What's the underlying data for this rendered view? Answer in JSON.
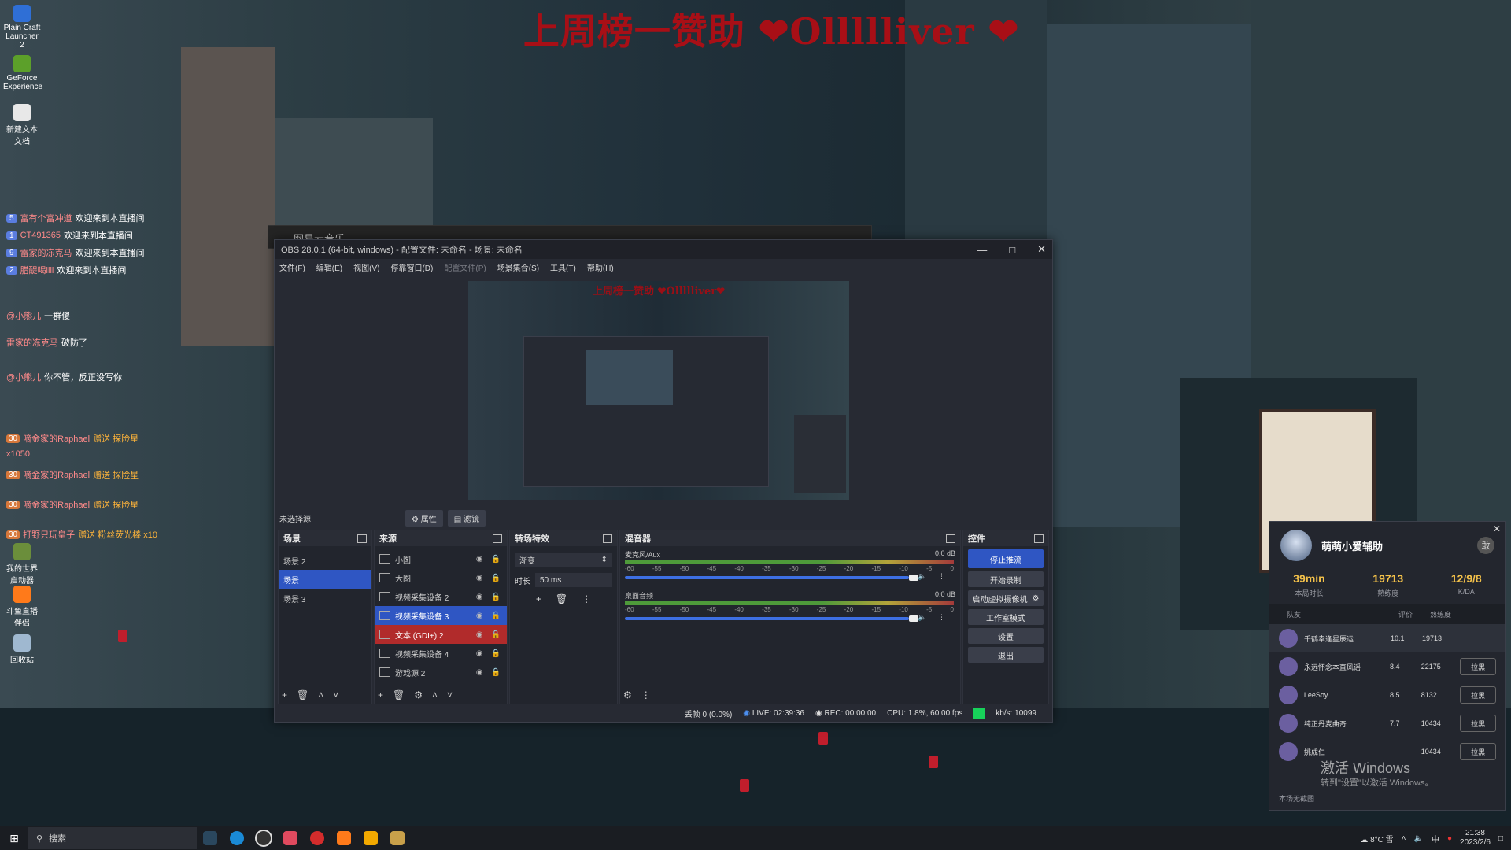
{
  "overlay_title": "上周榜一赞助 ❤Ollllliver ❤",
  "desktop_icons": [
    {
      "label": "Plain Craft Launcher 2",
      "icon": "plain-craft-icon",
      "color": "#2f6fd6"
    },
    {
      "label": "GeForce Experience",
      "icon": "geforce-icon",
      "color": "#5ca02a"
    },
    {
      "label": "新建文本文档",
      "icon": "text-doc-icon",
      "color": "#e8e8e8"
    },
    {
      "label": "我的世界启动器",
      "icon": "minecraft-icon",
      "color": "#6b8e3b"
    },
    {
      "label": "斗鱼直播伴侣",
      "icon": "douyu-icon",
      "color": "#ff7a1a"
    },
    {
      "label": "回收站",
      "icon": "recycle-bin-icon",
      "color": "#9fb8d0"
    }
  ],
  "chat": [
    {
      "level": "5",
      "user": "富有个富冲道",
      "text": "欢迎来到本直播间"
    },
    {
      "level": "1",
      "user": "CT491365",
      "text": "欢迎来到本直播间"
    },
    {
      "level": "9",
      "user": "雷家的冻克马",
      "text": "欢迎来到本直播间"
    },
    {
      "level": "2",
      "user": "腊醍喝illl",
      "text": "欢迎来到本直播间"
    },
    {
      "level": "",
      "user": "@小熊儿",
      "text": "一群傻"
    },
    {
      "level": "",
      "user": "雷家的冻克马",
      "text": "破防了"
    },
    {
      "level": "",
      "user": "@小熊儿",
      "text": "你不管，反正没写你"
    },
    {
      "level": "30",
      "user": "嘀金家的Raphael",
      "text": "赠送 探险星"
    },
    {
      "level": "",
      "user": "x1050",
      "text": ""
    },
    {
      "level": "30",
      "user": "嘀金家的Raphael",
      "text": "赠送 探险星"
    },
    {
      "level": "30",
      "user": "嘀金家的Raphael",
      "text": "赠送 探险星"
    },
    {
      "level": "30",
      "user": "打野只玩皇子",
      "text": "赠送 粉丝荧光棒 x10"
    }
  ],
  "music_window": {
    "title": "网易云音乐"
  },
  "obs": {
    "title": "OBS 28.0.1 (64-bit, windows) - 配置文件: 未命名 - 场景: 未命名",
    "menu": [
      {
        "label": "文件(F)",
        "disabled": false
      },
      {
        "label": "编辑(E)",
        "disabled": false
      },
      {
        "label": "视图(V)",
        "disabled": false
      },
      {
        "label": "停靠窗口(D)",
        "disabled": false
      },
      {
        "label": "配置文件(P)",
        "disabled": true
      },
      {
        "label": "场景集合(S)",
        "disabled": false
      },
      {
        "label": "工具(T)",
        "disabled": false
      },
      {
        "label": "帮助(H)",
        "disabled": false
      }
    ],
    "preview_title": "上周榜一赞助 ❤Ollllliver❤",
    "no_source": "未选择源",
    "props_tab": "属性",
    "filters_tab": "滤镜",
    "scenes": {
      "header": "场景",
      "items": [
        {
          "label": "场景 2",
          "selected": false
        },
        {
          "label": "场景",
          "selected": true
        },
        {
          "label": "场景 3",
          "selected": false
        }
      ]
    },
    "sources": {
      "header": "来源",
      "items": [
        {
          "label": "小图",
          "state": "normal"
        },
        {
          "label": "大图",
          "state": "normal"
        },
        {
          "label": "视频采集设备 2",
          "state": "normal"
        },
        {
          "label": "视频采集设备 3",
          "state": "selected"
        },
        {
          "label": "文本 (GDI+) 2",
          "state": "red"
        },
        {
          "label": "视频采集设备 4",
          "state": "normal"
        },
        {
          "label": "游戏源 2",
          "state": "normal"
        }
      ]
    },
    "transitions": {
      "header": "转场特效",
      "selected": "渐变",
      "duration_label": "时长",
      "duration_value": "50 ms"
    },
    "mixer": {
      "header": "混音器",
      "tracks": [
        {
          "name": "麦克风/Aux",
          "db": "0.0 dB",
          "level": 0.88
        },
        {
          "name": "桌面音频",
          "db": "0.0 dB",
          "level": 0.88
        }
      ],
      "scale": [
        "-60",
        "-55",
        "-50",
        "-45",
        "-40",
        "-35",
        "-30",
        "-25",
        "-20",
        "-15",
        "-10",
        "-5",
        "0"
      ]
    },
    "controls": {
      "header": "控件",
      "stop_stream": "停止推流",
      "start_record": "开始录制",
      "virtual_cam": "启动虚拟摄像机",
      "studio_mode": "工作室模式",
      "settings": "设置",
      "exit": "退出"
    },
    "status": {
      "dropped": "丢帧 0 (0.0%)",
      "live": "LIVE: 02:39:36",
      "rec": "REC: 00:00:00",
      "cpu": "CPU: 1.8%, 60.00 fps",
      "kbps": "kb/s: 10099"
    }
  },
  "game_panel": {
    "name": "萌萌小爱辅助",
    "badge": "敢",
    "stats": [
      {
        "value": "39min",
        "label": "本局时长"
      },
      {
        "value": "19713",
        "label": "熟练度"
      },
      {
        "value": "12/9/8",
        "label": "K/DA"
      }
    ],
    "table_head": [
      "队友",
      "评价",
      "熟练度"
    ],
    "rows": [
      {
        "name": "千鹤幸逢星辰运",
        "score": "10.1",
        "prof": "19713",
        "button": ""
      },
      {
        "name": "永远怀念本直风谣",
        "score": "8.4",
        "prof": "22175",
        "button": "拉黑"
      },
      {
        "name": "LeeSoy",
        "score": "8.5",
        "prof": "8132",
        "button": "拉黑"
      },
      {
        "name": "纯正丹麦曲奇",
        "score": "7.7",
        "prof": "10434",
        "button": "拉黑"
      },
      {
        "name": "姚成仁",
        "score": "",
        "prof": "10434",
        "button": "拉黑"
      }
    ],
    "footer": "本场无截图"
  },
  "watermark": {
    "line1": "激活 Windows",
    "line2": "转到\"设置\"以激活 Windows。"
  },
  "taskbar": {
    "search": "搜索",
    "weather": "8°C 雪",
    "ime": "中",
    "time": "21:38",
    "date": "2023/2/6"
  }
}
